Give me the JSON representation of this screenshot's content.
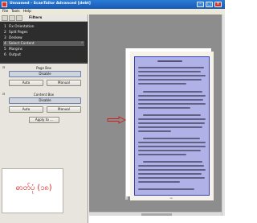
{
  "window": {
    "title": "Unnamed - ScanTailor Advanced [debt]",
    "controls": [
      "–",
      "□",
      "×"
    ]
  },
  "menu": [
    "File",
    "Tools",
    "Help"
  ],
  "panel": {
    "title": "Filters"
  },
  "filters": [
    {
      "num": "1",
      "label": "Fix Orientation"
    },
    {
      "num": "2",
      "label": "Split Pages"
    },
    {
      "num": "3",
      "label": "Deskew"
    },
    {
      "num": "4",
      "label": "Select Content",
      "selected": true
    },
    {
      "num": "5",
      "label": "Margins"
    },
    {
      "num": "6",
      "label": "Output"
    }
  ],
  "page_box": {
    "label": "Page Box",
    "disable": "Disable",
    "auto": "Auto",
    "manual": "Manual"
  },
  "content_box": {
    "label": "Content Box",
    "disable": "Disable",
    "auto": "Auto",
    "manual": "Manual"
  },
  "apply_to": "Apply to ...",
  "sample_text": "ဓာတ်ပုံ (၁၈)",
  "page_number": "၁၈",
  "colors": {
    "titlebar": "#1f6bc6",
    "panel_dark": "#2d2d2d",
    "content_box_fill": "#b0b1e6",
    "content_box_border": "#3140bd",
    "annotation_red": "#d11c1c"
  }
}
